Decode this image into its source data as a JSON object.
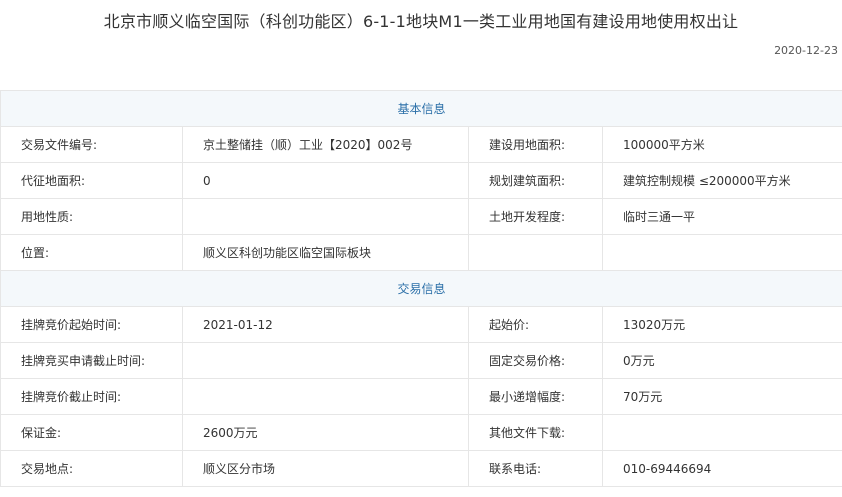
{
  "page": {
    "title": "北京市顺义临空国际（科创功能区）6-1-1地块M1一类工业用地国有建设用地使用权出让",
    "date": "2020-12-23"
  },
  "basic": {
    "heading": "基本信息",
    "rows": [
      [
        {
          "label": "交易文件编号:",
          "value": "京土整储挂（顺）工业【2020】002号"
        },
        {
          "label": "建设用地面积:",
          "value": "100000平方米"
        }
      ],
      [
        {
          "label": "代征地面积:",
          "value": "0"
        },
        {
          "label": "规划建筑面积:",
          "value": "建筑控制规模 ≤200000平方米"
        }
      ],
      [
        {
          "label": "用地性质:",
          "value": ""
        },
        {
          "label": "土地开发程度:",
          "value": "临时三通一平"
        }
      ],
      [
        {
          "label": "位置:",
          "value": "顺义区科创功能区临空国际板块"
        },
        {
          "label": "",
          "value": ""
        }
      ]
    ]
  },
  "trade": {
    "heading": "交易信息",
    "rows": [
      [
        {
          "label": "挂牌竞价起始时间:",
          "value": "2021-01-12"
        },
        {
          "label": "起始价:",
          "value": "13020万元"
        }
      ],
      [
        {
          "label": "挂牌竞买申请截止时间:",
          "value": ""
        },
        {
          "label": "固定交易价格:",
          "value": "0万元"
        }
      ],
      [
        {
          "label": "挂牌竞价截止时间:",
          "value": ""
        },
        {
          "label": "最小递增幅度:",
          "value": "70万元"
        }
      ],
      [
        {
          "label": "保证金:",
          "value": "2600万元"
        },
        {
          "label": "其他文件下载:",
          "value": ""
        }
      ],
      [
        {
          "label": "交易地点:",
          "value": "顺义区分市场"
        },
        {
          "label": "联系电话:",
          "value": "010-69446694"
        }
      ]
    ]
  }
}
